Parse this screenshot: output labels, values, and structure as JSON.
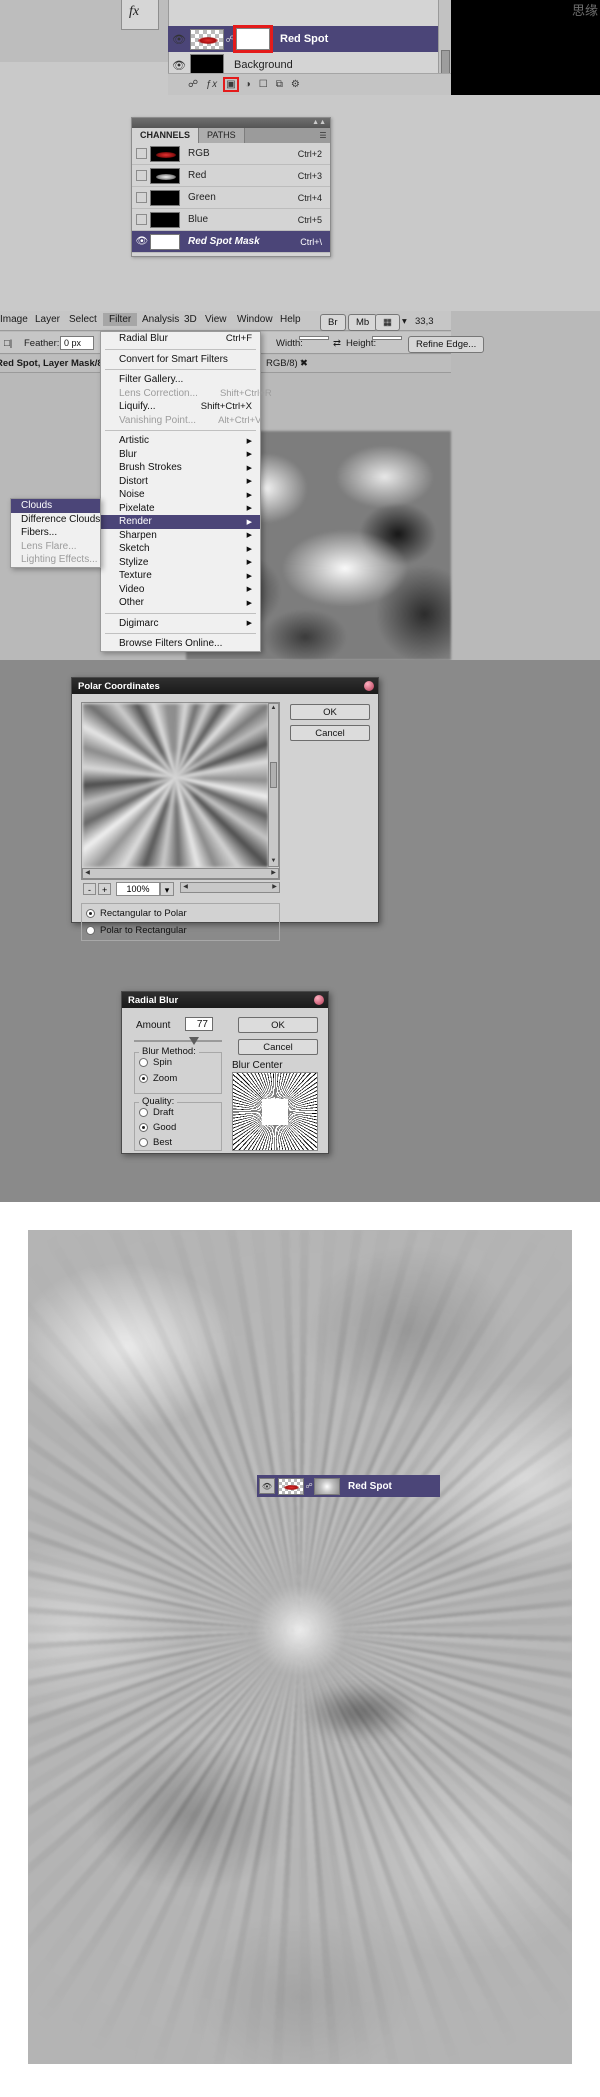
{
  "layers_panel": {
    "fx_icon": "fx-icon",
    "rows": [
      {
        "name": "Red Spot",
        "selected": true,
        "eye": "eye-icon",
        "thumb": "layer-thumbnail",
        "mask": "layer-mask-thumbnail",
        "mask_highlighted": true
      },
      {
        "name": "Background",
        "selected": false,
        "eye": "eye-icon",
        "thumb": "background-thumbnail"
      }
    ],
    "bottom_icons": [
      "link-icon",
      "fx-icon",
      "mask-icon",
      "adjustment-icon",
      "group-icon",
      "new-layer-icon",
      "delete-icon"
    ],
    "highlighted_bottom_icon": "mask-icon",
    "watermark": "思缘"
  },
  "channels_panel": {
    "tabs": [
      {
        "label": "CHANNELS",
        "active": true
      },
      {
        "label": "PATHS",
        "active": false
      }
    ],
    "menu_icon": "panel-menu-icon",
    "rows": [
      {
        "name": "RGB",
        "shortcut": "Ctrl+2",
        "selected": false,
        "visible": false,
        "thumb": "rgb-thumb"
      },
      {
        "name": "Red",
        "shortcut": "Ctrl+3",
        "selected": false,
        "visible": false,
        "thumb": "red-thumb"
      },
      {
        "name": "Green",
        "shortcut": "Ctrl+4",
        "selected": false,
        "visible": false,
        "thumb": "green-thumb"
      },
      {
        "name": "Blue",
        "shortcut": "Ctrl+5",
        "selected": false,
        "visible": false,
        "thumb": "blue-thumb"
      },
      {
        "name": "Red Spot Mask",
        "shortcut": "Ctrl+\\",
        "selected": true,
        "visible": true,
        "thumb": "mask-thumb"
      }
    ]
  },
  "filter_screen": {
    "menubar": [
      {
        "label": "Image",
        "active": false
      },
      {
        "label": "Layer",
        "active": false
      },
      {
        "label": "Select",
        "active": false
      },
      {
        "label": "Filter",
        "active": true
      },
      {
        "label": "Analysis",
        "active": false
      },
      {
        "label": "3D",
        "active": false
      },
      {
        "label": "View",
        "active": false
      },
      {
        "label": "Window",
        "active": false
      },
      {
        "label": "Help",
        "active": false
      }
    ],
    "right_buttons": [
      "Br",
      "Mb"
    ],
    "screen_mode_icon": "screen-mode-icon",
    "zoom_value": "33,3",
    "options": {
      "feather_label": "Feather:",
      "feather_value": "0 px",
      "antialias_checkbox": "anti-alias-checkbox",
      "width_label": "Width:",
      "height_label": "Height:",
      "refine_edge_label": "Refine Edge..."
    },
    "doc_title": "Red Spot, Layer Mask/8)",
    "doc_title_right": "RGB/8) *",
    "filter_menu": [
      {
        "label": "Radial Blur",
        "shortcut": "Ctrl+F",
        "disabled": false,
        "submenu": false
      },
      {
        "sep": true
      },
      {
        "label": "Convert for Smart Filters",
        "shortcut": "",
        "disabled": false,
        "submenu": false
      },
      {
        "sep": true
      },
      {
        "label": "Filter Gallery...",
        "shortcut": "",
        "disabled": false,
        "submenu": false
      },
      {
        "label": "Lens Correction...",
        "shortcut": "Shift+Ctrl+R",
        "disabled": true,
        "submenu": false
      },
      {
        "label": "Liquify...",
        "shortcut": "Shift+Ctrl+X",
        "disabled": false,
        "submenu": false
      },
      {
        "label": "Vanishing Point...",
        "shortcut": "Alt+Ctrl+V",
        "disabled": true,
        "submenu": false
      },
      {
        "sep": true
      },
      {
        "label": "Artistic",
        "shortcut": "",
        "disabled": false,
        "submenu": true
      },
      {
        "label": "Blur",
        "shortcut": "",
        "disabled": false,
        "submenu": true
      },
      {
        "label": "Brush Strokes",
        "shortcut": "",
        "disabled": false,
        "submenu": true
      },
      {
        "label": "Distort",
        "shortcut": "",
        "disabled": false,
        "submenu": true
      },
      {
        "label": "Noise",
        "shortcut": "",
        "disabled": false,
        "submenu": true
      },
      {
        "label": "Pixelate",
        "shortcut": "",
        "disabled": false,
        "submenu": true
      },
      {
        "label": "Render",
        "shortcut": "",
        "disabled": false,
        "submenu": true,
        "highlighted": true
      },
      {
        "label": "Sharpen",
        "shortcut": "",
        "disabled": false,
        "submenu": true
      },
      {
        "label": "Sketch",
        "shortcut": "",
        "disabled": false,
        "submenu": true
      },
      {
        "label": "Stylize",
        "shortcut": "",
        "disabled": false,
        "submenu": true
      },
      {
        "label": "Texture",
        "shortcut": "",
        "disabled": false,
        "submenu": true
      },
      {
        "label": "Video",
        "shortcut": "",
        "disabled": false,
        "submenu": true
      },
      {
        "label": "Other",
        "shortcut": "",
        "disabled": false,
        "submenu": true
      },
      {
        "sep": true
      },
      {
        "label": "Digimarc",
        "shortcut": "",
        "disabled": false,
        "submenu": true
      },
      {
        "sep": true
      },
      {
        "label": "Browse Filters Online...",
        "shortcut": "",
        "disabled": false,
        "submenu": false
      }
    ],
    "render_submenu": [
      {
        "label": "Clouds",
        "disabled": false,
        "highlighted": true
      },
      {
        "label": "Difference Clouds",
        "disabled": false,
        "highlighted": false
      },
      {
        "label": "Fibers...",
        "disabled": false,
        "highlighted": false
      },
      {
        "label": "Lens Flare...",
        "disabled": true,
        "highlighted": false
      },
      {
        "label": "Lighting Effects...",
        "disabled": true,
        "highlighted": false
      }
    ]
  },
  "polar_dialog": {
    "title": "Polar Coordinates",
    "ok_label": "OK",
    "cancel_label": "Cancel",
    "zoom_out_label": "-",
    "zoom_in_label": "+",
    "zoom_value": "100%",
    "zoom_dropdown_icon": "chevron-down-icon",
    "options": [
      {
        "label": "Rectangular to Polar",
        "checked": true
      },
      {
        "label": "Polar to Rectangular",
        "checked": false
      }
    ],
    "preview_name": "polar-preview"
  },
  "radial_blur_dialog": {
    "title": "Radial Blur",
    "amount_label": "Amount",
    "amount_value": "77",
    "ok_label": "OK",
    "cancel_label": "Cancel",
    "blur_method_label": "Blur Method:",
    "blur_methods": [
      {
        "label": "Spin",
        "checked": false
      },
      {
        "label": "Zoom",
        "checked": true
      }
    ],
    "quality_label": "Quality:",
    "qualities": [
      {
        "label": "Draft",
        "checked": false
      },
      {
        "label": "Good",
        "checked": true
      },
      {
        "label": "Best",
        "checked": false
      }
    ],
    "blur_center_label": "Blur Center"
  },
  "result": {
    "mini_layer": {
      "name": "Red Spot",
      "eye": "eye-icon",
      "thumb": "layer-thumbnail",
      "link": "link-icon",
      "mask": "layer-mask-thumbnail"
    }
  },
  "colors": {
    "selection_purple": "#4b4578",
    "highlight_red": "#e41b1b",
    "panel_grey": "#d2d2d2",
    "app_grey": "#b9b9b9"
  }
}
